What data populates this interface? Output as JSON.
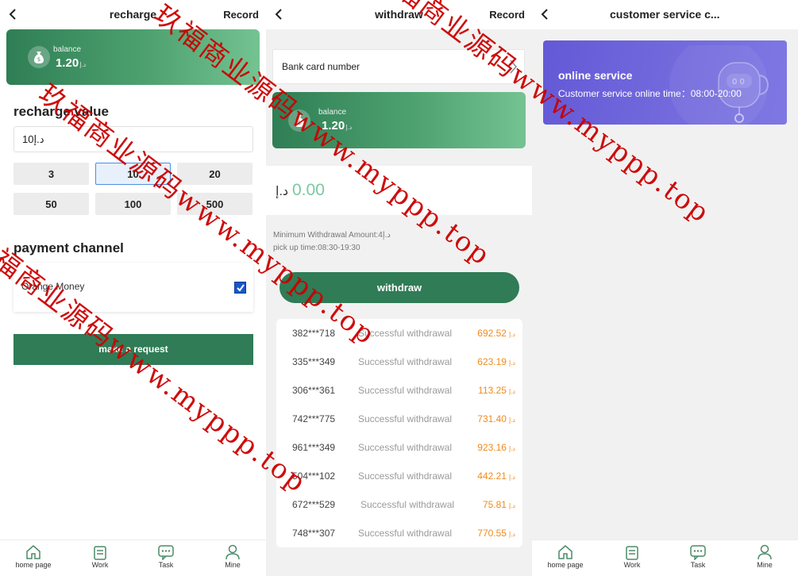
{
  "recharge_panel": {
    "title": "recharge",
    "record_label": "Record",
    "balance_label": "balance",
    "balance_value": "1.20",
    "currency": "د.إ",
    "recharge_value_title": "recharge value",
    "amount_input_value": "10",
    "amount_options": [
      "3",
      "10",
      "20",
      "50",
      "100",
      "500"
    ],
    "selected_amount": "10",
    "payment_channel_title": "payment channel",
    "channel_name": "Orange Money",
    "channel_checked": true,
    "submit_label": "make a request"
  },
  "withdraw_panel": {
    "title": "withdraw",
    "record_label": "Record",
    "bank_card_label": "Bank card number",
    "balance_label": "balance",
    "balance_value": "1.20",
    "currency": "د.إ",
    "amount_value": "0.00",
    "min_amount_text": "Minimum Withdrawal Amount:4د.إ",
    "pickup_time_text": "pick up time:08:30-19:30",
    "withdraw_label": "withdraw",
    "records": [
      {
        "account": "382***718",
        "status": "Successful withdrawal",
        "amount": "692.52"
      },
      {
        "account": "335***349",
        "status": "Successful withdrawal",
        "amount": "623.19"
      },
      {
        "account": "306***361",
        "status": "Successful withdrawal",
        "amount": "113.25"
      },
      {
        "account": "742***775",
        "status": "Successful withdrawal",
        "amount": "731.40"
      },
      {
        "account": "961***349",
        "status": "Successful withdrawal",
        "amount": "923.16"
      },
      {
        "account": "504***102",
        "status": "Successful withdrawal",
        "amount": "442.21"
      },
      {
        "account": "672***529",
        "status": "Successful withdrawal",
        "amount": "75.81"
      },
      {
        "account": "748***307",
        "status": "Successful withdrawal",
        "amount": "770.55"
      }
    ]
  },
  "service_panel": {
    "title": "customer service c...",
    "card_title": "online service",
    "card_subtitle": "Customer service online time：08:00-20:00"
  },
  "tabbar": {
    "home": "home page",
    "work": "Work",
    "task": "Task",
    "mine": "Mine"
  },
  "watermark": {
    "line_a": "玖福商业源码www.myppp.top",
    "line_b": "福商业源码www.myppp.top"
  },
  "colors": {
    "brand_green": "#2f7c56",
    "amount_orange": "#f08a1c",
    "service_purple": "#6459d6",
    "watermark_red": "#cc0000"
  }
}
